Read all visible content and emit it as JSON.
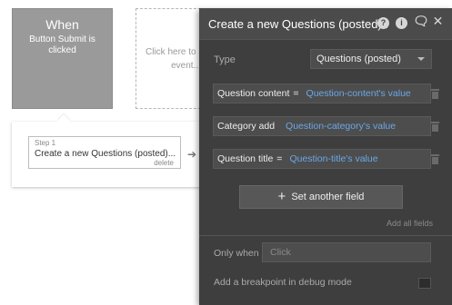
{
  "event": {
    "title": "When",
    "description": "Button Submit is clicked",
    "placeholder": "Click here to add an event..."
  },
  "step": {
    "number_label": "Step 1",
    "title": "Create a new Questions (posted)...",
    "delete_label": "delete"
  },
  "panel": {
    "title": "Create a new Questions (posted)..",
    "icons": [
      "help-icon",
      "info-icon",
      "comment-icon",
      "close-icon"
    ],
    "type_label": "Type",
    "type_value": "Questions (posted)",
    "fields": [
      {
        "name": "Question content",
        "op": "=",
        "value": "Question-content's value"
      },
      {
        "name": "Category add",
        "op": "",
        "value": "Question-category's value"
      },
      {
        "name": "Question title",
        "op": "=",
        "value": "Question-title's value"
      }
    ],
    "set_field_label": "Set another field",
    "add_all_label": "Add all fields",
    "only_when_label": "Only when",
    "only_when_placeholder": "Click",
    "breakpoint_label": "Add a breakpoint in debug mode"
  },
  "colors": {
    "panel_bg": "#3e3e3e",
    "dynamic_value": "#6aa8e8",
    "event_card": "#9a9a9a"
  }
}
